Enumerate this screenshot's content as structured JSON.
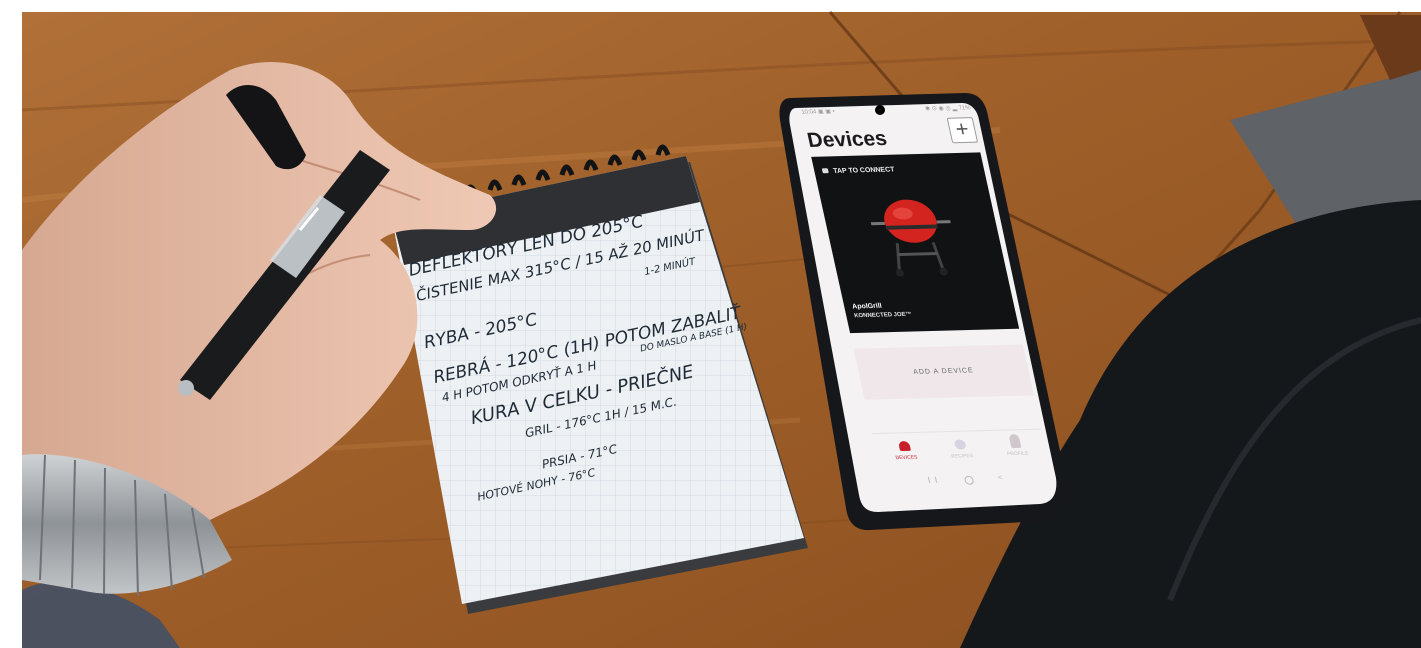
{
  "phone": {
    "status_left": "10:04 ▣ ▣ •",
    "status_right": "✱ ⊙ ◉ ◎ ▂ 71%",
    "title": "Devices",
    "add_icon": "plus-icon",
    "card": {
      "tap_label": "TAP TO CONNECT",
      "brand": "ApolGrill",
      "model": "KONNECTED JOE™"
    },
    "add_device_label": "ADD A DEVICE",
    "nav": [
      {
        "label": "DEVICES",
        "icon": "grill-icon",
        "active": true
      },
      {
        "label": "RECIPES",
        "icon": "recipe-icon",
        "active": false
      },
      {
        "label": "PROFILE",
        "icon": "person-icon",
        "active": false
      }
    ],
    "accent": "#c8202a"
  },
  "notebook": {
    "lines": [
      "DEFLEKTORY LEN DO 205°C",
      "ČISTENIE MAX 315°C / 15 AŽ 20 MINÚT",
      "1-2 MINÚT",
      "RYBA - 205°C",
      "REBRÁ - 120°C (1H) POTOM ZABALIŤ",
      "DO MASLO A BASE (1 H)",
      "4 H   POTOM ODKRYŤ A 1 H",
      "KURA V CELKU - PRIEČNE",
      "GRIL - 176°C 1H / 15 M.C.",
      "PRSIA - 71°C",
      "HOTOVÉ   NOHY - 76°C"
    ]
  }
}
